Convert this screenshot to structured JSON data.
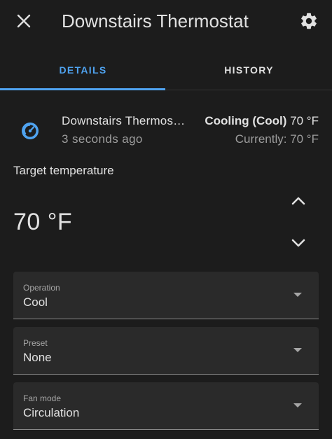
{
  "header": {
    "title": "Downstairs Thermostat",
    "close_icon": "close-icon",
    "settings_icon": "gear-icon"
  },
  "tabs": [
    {
      "label": "DETAILS",
      "active": true
    },
    {
      "label": "HISTORY",
      "active": false
    }
  ],
  "entity": {
    "name": "Downstairs Thermostat",
    "last_changed": "3 seconds ago",
    "state_mode": "Cooling (Cool)",
    "state_temp": "70 °F",
    "current": "Currently: 70 °F",
    "icon": "thermostat-icon",
    "icon_color": "#4fa3f0"
  },
  "target": {
    "label": "Target temperature",
    "value": "70 °F",
    "up_icon": "chevron-up-icon",
    "down_icon": "chevron-down-icon"
  },
  "fields": {
    "operation": {
      "label": "Operation",
      "value": "Cool"
    },
    "preset": {
      "label": "Preset",
      "value": "None"
    },
    "fan_mode": {
      "label": "Fan mode",
      "value": "Circulation"
    }
  },
  "colors": {
    "background": "#1c1c1c",
    "accent": "#4fa3f0",
    "field_bg": "#2a2a2a"
  }
}
